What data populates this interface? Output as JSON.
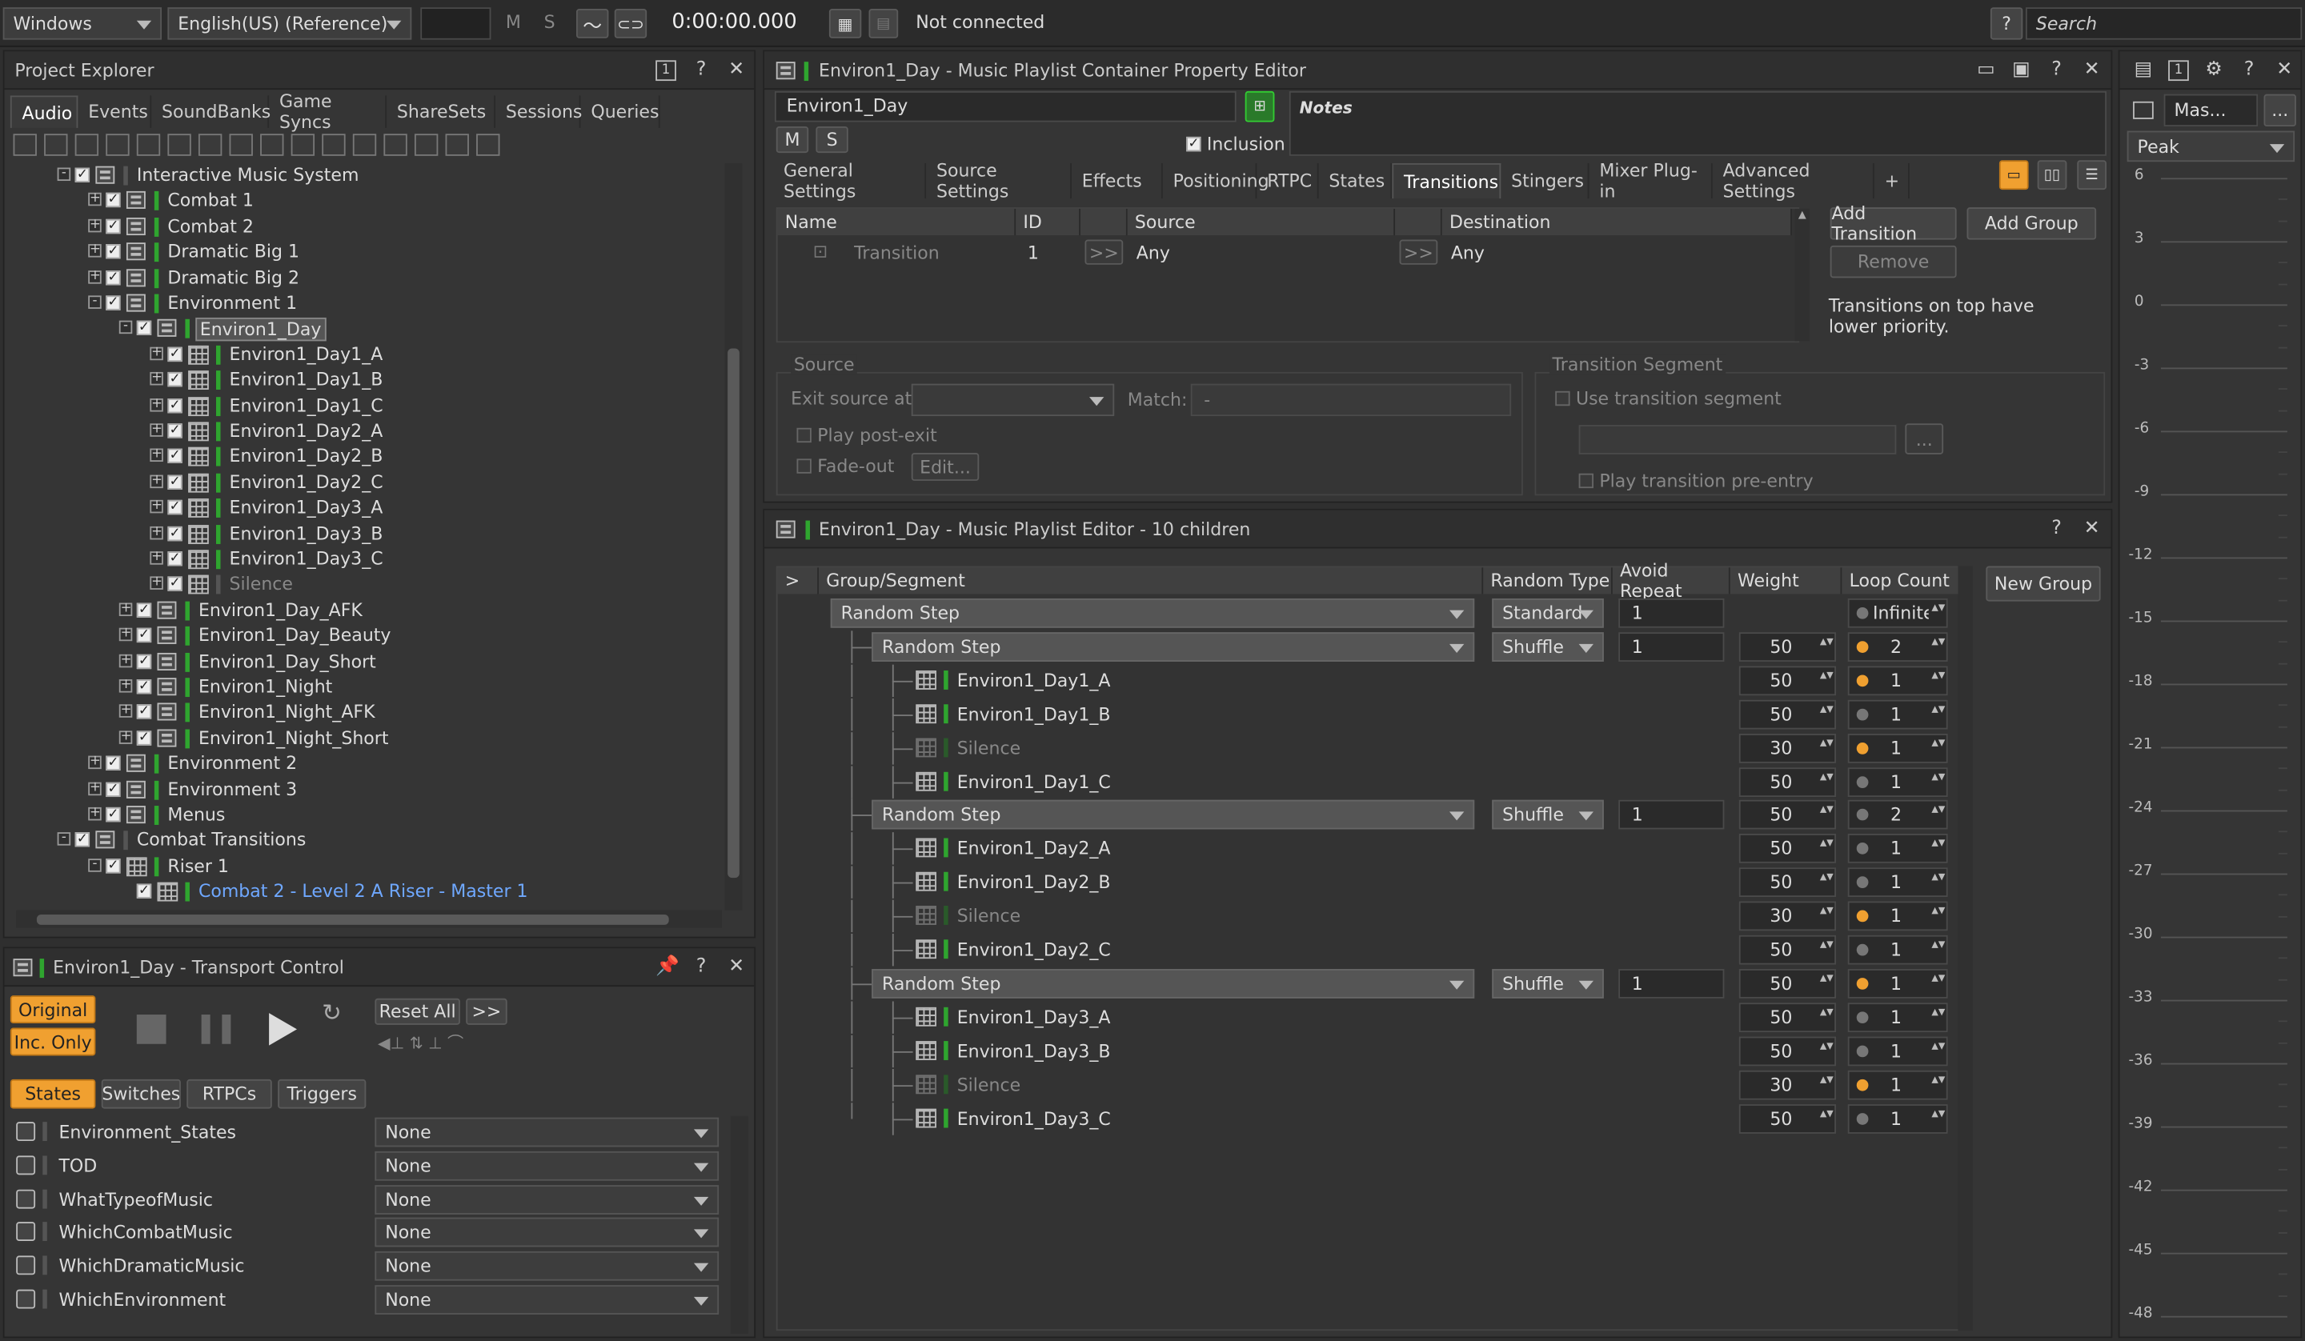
{
  "toolbar": {
    "layout": "Windows",
    "language": "English(US) (Reference)",
    "m": "M",
    "s": "S",
    "time": "0:00:00.000",
    "connection": "Not connected",
    "help": "?",
    "search": "Search"
  },
  "project_explorer": {
    "title": "Project Explorer",
    "tabs": [
      "Audio",
      "Events",
      "SoundBanks",
      "Game Syncs",
      "ShareSets",
      "Sessions",
      "Queries"
    ],
    "tree": [
      {
        "label": "Interactive Music System",
        "depth": 3,
        "icon": "work-unit",
        "exp": "-"
      },
      {
        "label": "Combat 1",
        "depth": 4,
        "icon": "switch",
        "exp": "+"
      },
      {
        "label": "Combat 2",
        "depth": 4,
        "icon": "switch",
        "exp": "+"
      },
      {
        "label": "Dramatic Big 1",
        "depth": 4,
        "icon": "switch",
        "exp": "+"
      },
      {
        "label": "Dramatic Big 2",
        "depth": 4,
        "icon": "switch",
        "exp": "+"
      },
      {
        "label": "Environment 1",
        "depth": 4,
        "icon": "switch",
        "exp": "-"
      },
      {
        "label": "Environ1_Day",
        "depth": 5,
        "icon": "playlist",
        "exp": "-",
        "selected": true
      },
      {
        "label": "Environ1_Day1_A",
        "depth": 6,
        "icon": "segment",
        "exp": "+"
      },
      {
        "label": "Environ1_Day1_B",
        "depth": 6,
        "icon": "segment",
        "exp": "+"
      },
      {
        "label": "Environ1_Day1_C",
        "depth": 6,
        "icon": "segment",
        "exp": "+"
      },
      {
        "label": "Environ1_Day2_A",
        "depth": 6,
        "icon": "segment",
        "exp": "+"
      },
      {
        "label": "Environ1_Day2_B",
        "depth": 6,
        "icon": "segment",
        "exp": "+"
      },
      {
        "label": "Environ1_Day2_C",
        "depth": 6,
        "icon": "segment",
        "exp": "+"
      },
      {
        "label": "Environ1_Day3_A",
        "depth": 6,
        "icon": "segment",
        "exp": "+"
      },
      {
        "label": "Environ1_Day3_B",
        "depth": 6,
        "icon": "segment",
        "exp": "+"
      },
      {
        "label": "Environ1_Day3_C",
        "depth": 6,
        "icon": "segment",
        "exp": "+"
      },
      {
        "label": "Silence",
        "depth": 6,
        "icon": "segment",
        "exp": "+",
        "dim": true
      },
      {
        "label": "Environ1_Day_AFK",
        "depth": 5,
        "icon": "playlist",
        "exp": "+"
      },
      {
        "label": "Environ1_Day_Beauty",
        "depth": 5,
        "icon": "playlist",
        "exp": "+"
      },
      {
        "label": "Environ1_Day_Short",
        "depth": 5,
        "icon": "playlist",
        "exp": "+"
      },
      {
        "label": "Environ1_Night",
        "depth": 5,
        "icon": "playlist",
        "exp": "+"
      },
      {
        "label": "Environ1_Night_AFK",
        "depth": 5,
        "icon": "playlist",
        "exp": "+"
      },
      {
        "label": "Environ1_Night_Short",
        "depth": 5,
        "icon": "playlist",
        "exp": "+"
      },
      {
        "label": "Environment 2",
        "depth": 4,
        "icon": "switch",
        "exp": "+"
      },
      {
        "label": "Environment 3",
        "depth": 4,
        "icon": "switch",
        "exp": "+"
      },
      {
        "label": "Menus",
        "depth": 4,
        "icon": "switch",
        "exp": "+"
      },
      {
        "label": "Combat Transitions",
        "depth": 3,
        "icon": "work-unit",
        "exp": "-"
      },
      {
        "label": "Riser 1",
        "depth": 4,
        "icon": "segment",
        "exp": "-"
      },
      {
        "label": "Combat 2 - Level 2 A Riser - Master 1",
        "depth": 5,
        "icon": "track",
        "exp": "",
        "link": true
      }
    ]
  },
  "transport": {
    "title": "Environ1_Day - Transport Control",
    "original": "Original",
    "inc_only": "Inc. Only",
    "reset_all": "Reset All",
    "more": ">>",
    "tabs": [
      "States",
      "Switches",
      "RTPCs",
      "Triggers"
    ],
    "states": [
      {
        "name": "Environment_States",
        "value": "None"
      },
      {
        "name": "TOD",
        "value": "None"
      },
      {
        "name": "WhatTypeofMusic",
        "value": "None"
      },
      {
        "name": "WhichCombatMusic",
        "value": "None"
      },
      {
        "name": "WhichDramaticMusic",
        "value": "None"
      },
      {
        "name": "WhichEnvironment",
        "value": "None"
      }
    ]
  },
  "property_editor": {
    "title": "Environ1_Day - Music Playlist Container Property Editor",
    "name": "Environ1_Day",
    "m": "M",
    "s": "S",
    "inclusion": "Inclusion",
    "notes": "Notes",
    "tabs": [
      "General Settings",
      "Source Settings",
      "Effects",
      "Positioning",
      "RTPC",
      "States",
      "Transitions",
      "Stingers",
      "Mixer Plug-in",
      "Advanced Settings",
      "+"
    ],
    "active_tab": "Transitions",
    "columns": [
      "Name",
      "ID",
      "Source",
      "Destination"
    ],
    "transition": {
      "name": "Transition",
      "id": "1",
      "btn": ">>",
      "source": "Any",
      "dest": "Any"
    },
    "add_transition": "Add Transition",
    "add_group": "Add Group",
    "remove": "Remove",
    "priority_note": "Transitions on top have lower priority.",
    "source_group": "Source",
    "exit_source_at": "Exit source at",
    "match": "Match:",
    "match_value": "-",
    "play_post_exit": "Play post-exit",
    "fade_out": "Fade-out",
    "edit": "Edit...",
    "segment_group": "Transition Segment",
    "use_segment": "Use transition segment",
    "ellipsis": "...",
    "pre_entry": "Play transition pre-entry"
  },
  "playlist_editor": {
    "title": "Environ1_Day - Music Playlist Editor - 10 children",
    "columns": [
      ">",
      "Group/Segment",
      "Random Type",
      "Avoid Repeat",
      "Weight",
      "Loop Count"
    ],
    "new_group": "New Group",
    "rows": [
      {
        "type": "group",
        "indent": 0,
        "label": "Random Step",
        "random_type": "Standard",
        "avoid": "1",
        "weight": "",
        "loop_dot": "gray",
        "loop": "Infinite"
      },
      {
        "type": "group",
        "indent": 1,
        "label": "Random Step",
        "random_type": "Shuffle",
        "avoid": "1",
        "weight": "50",
        "loop_dot": "orange",
        "loop": "2"
      },
      {
        "type": "seg",
        "indent": 2,
        "label": "Environ1_Day1_A",
        "weight": "50",
        "loop_dot": "orange",
        "loop": "1"
      },
      {
        "type": "seg",
        "indent": 2,
        "label": "Environ1_Day1_B",
        "weight": "50",
        "loop_dot": "gray",
        "loop": "1"
      },
      {
        "type": "seg",
        "indent": 2,
        "label": "Silence",
        "weight": "30",
        "loop_dot": "orange",
        "loop": "1",
        "dim": true
      },
      {
        "type": "seg",
        "indent": 2,
        "label": "Environ1_Day1_C",
        "weight": "50",
        "loop_dot": "gray",
        "loop": "1"
      },
      {
        "type": "group",
        "indent": 1,
        "label": "Random Step",
        "random_type": "Shuffle",
        "avoid": "1",
        "weight": "50",
        "loop_dot": "gray",
        "loop": "2"
      },
      {
        "type": "seg",
        "indent": 2,
        "label": "Environ1_Day2_A",
        "weight": "50",
        "loop_dot": "gray",
        "loop": "1"
      },
      {
        "type": "seg",
        "indent": 2,
        "label": "Environ1_Day2_B",
        "weight": "50",
        "loop_dot": "gray",
        "loop": "1"
      },
      {
        "type": "seg",
        "indent": 2,
        "label": "Silence",
        "weight": "30",
        "loop_dot": "orange",
        "loop": "1",
        "dim": true
      },
      {
        "type": "seg",
        "indent": 2,
        "label": "Environ1_Day2_C",
        "weight": "50",
        "loop_dot": "gray",
        "loop": "1"
      },
      {
        "type": "group",
        "indent": 1,
        "label": "Random Step",
        "random_type": "Shuffle",
        "avoid": "1",
        "weight": "50",
        "loop_dot": "orange",
        "loop": "1"
      },
      {
        "type": "seg",
        "indent": 2,
        "label": "Environ1_Day3_A",
        "weight": "50",
        "loop_dot": "gray",
        "loop": "1"
      },
      {
        "type": "seg",
        "indent": 2,
        "label": "Environ1_Day3_B",
        "weight": "50",
        "loop_dot": "gray",
        "loop": "1"
      },
      {
        "type": "seg",
        "indent": 2,
        "label": "Silence",
        "weight": "30",
        "loop_dot": "orange",
        "loop": "1",
        "dim": true
      },
      {
        "type": "seg",
        "indent": 2,
        "label": "Environ1_Day3_C",
        "weight": "50",
        "loop_dot": "gray",
        "loop": "1"
      }
    ]
  },
  "meter": {
    "bus": "Mas...",
    "more": "...",
    "mode": "Peak",
    "scale": [
      "6",
      "3",
      "0",
      "-3",
      "-6",
      "-9",
      "-12",
      "-15",
      "-18",
      "-21",
      "-24",
      "-27",
      "-30",
      "-33",
      "-36",
      "-39",
      "-42",
      "-45",
      "-48"
    ]
  },
  "colors": {
    "accent_orange": "#f0a030",
    "green": "#2fa52f",
    "link_blue": "#6fa8ff",
    "selection": "#555555"
  }
}
